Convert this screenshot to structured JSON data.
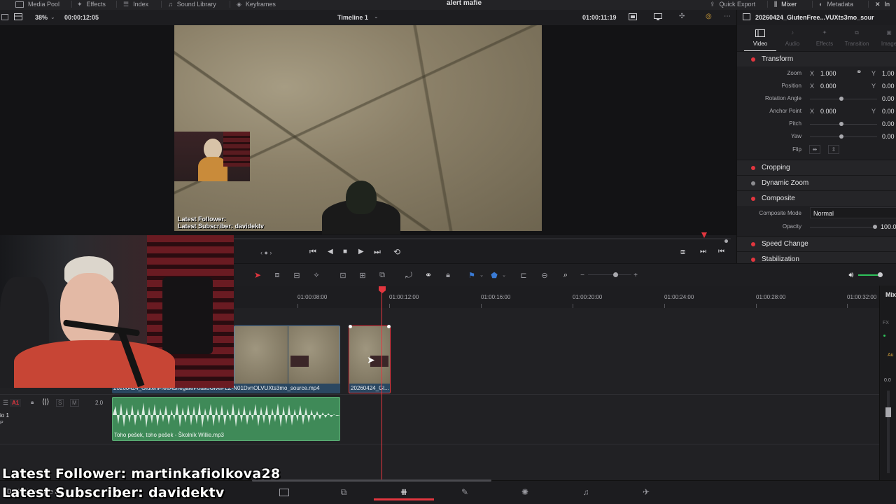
{
  "topbar": {
    "media_pool": "Media Pool",
    "effects": "Effects",
    "index": "Index",
    "sound_library": "Sound Library",
    "keyframes": "Keyframes",
    "project_title": "alert mafie",
    "quick_export": "Quick Export",
    "mixer": "Mixer",
    "metadata": "Metadata",
    "inspector_short": "In"
  },
  "viewer": {
    "zoom": "38%",
    "source_timecode": "00:00:12:05",
    "timeline_name": "Timeline 1",
    "record_timecode": "01:00:11:19",
    "overlay_follower": "Latest Follower:",
    "overlay_subscriber": "Latest Subscriber: davidektv"
  },
  "inspector": {
    "clip_name": "20260424_GlutenFree...VUXts3mo_sour",
    "tabs": [
      "Video",
      "Audio",
      "Effects",
      "Transition",
      "Image"
    ],
    "transform": {
      "title": "Transform",
      "zoom_label": "Zoom",
      "zoom_x": "1.000",
      "zoom_y": "1.00",
      "position_label": "Position",
      "position_x": "0.000",
      "position_y": "0.00",
      "rotation_label": "Rotation Angle",
      "rotation_val": "0.00",
      "anchor_label": "Anchor Point",
      "anchor_x": "0.000",
      "anchor_y": "0.00",
      "pitch_label": "Pitch",
      "pitch_val": "0.00",
      "yaw_label": "Yaw",
      "yaw_val": "0.00",
      "flip_label": "Flip",
      "axis_x": "X",
      "axis_y": "Y"
    },
    "cropping": "Cropping",
    "dynamic_zoom": "Dynamic Zoom",
    "composite": {
      "title": "Composite",
      "mode_label": "Composite Mode",
      "mode_value": "Normal",
      "opacity_label": "Opacity",
      "opacity_value": "100.0"
    },
    "speed_change": "Speed Change",
    "stabilization": "Stabilization"
  },
  "ruler": {
    "ticks": [
      "01:00:08:00",
      "01:00:12:00",
      "01:00:16:00",
      "01:00:20:00",
      "01:00:24:00",
      "01:00:28:00",
      "01:00:32:00"
    ]
  },
  "tracks": {
    "video_clip_1": "20260424_GlutenFreeAbnegatePotatoGivePLZ-N01DvnOLVUXts3mo_source.mp4",
    "video_clip_2": "20260424_Gl...",
    "audio_clip": "Toho pešek, toho pešek - Školník Willie.mp3",
    "audio_track_id": "A1",
    "audio_track_name": "io 1",
    "audio_track_level": "2.0",
    "audio_track_s": "S",
    "audio_track_m": "M",
    "audio_track_sub": "P"
  },
  "mixer": {
    "label": "Mix",
    "fx": "FX",
    "au": "Au",
    "level": "0.0"
  },
  "pagebar": {
    "app_name": "DaVinci Resolve 2"
  },
  "stream_overlay": {
    "follower": "Latest Follower: martinkafiolkova28",
    "subscriber": "Latest Subscriber: davidektv"
  },
  "colors": {
    "accent_red": "#e2363f",
    "video_clip": "#2a4761",
    "audio_clip": "#3f8a58"
  }
}
